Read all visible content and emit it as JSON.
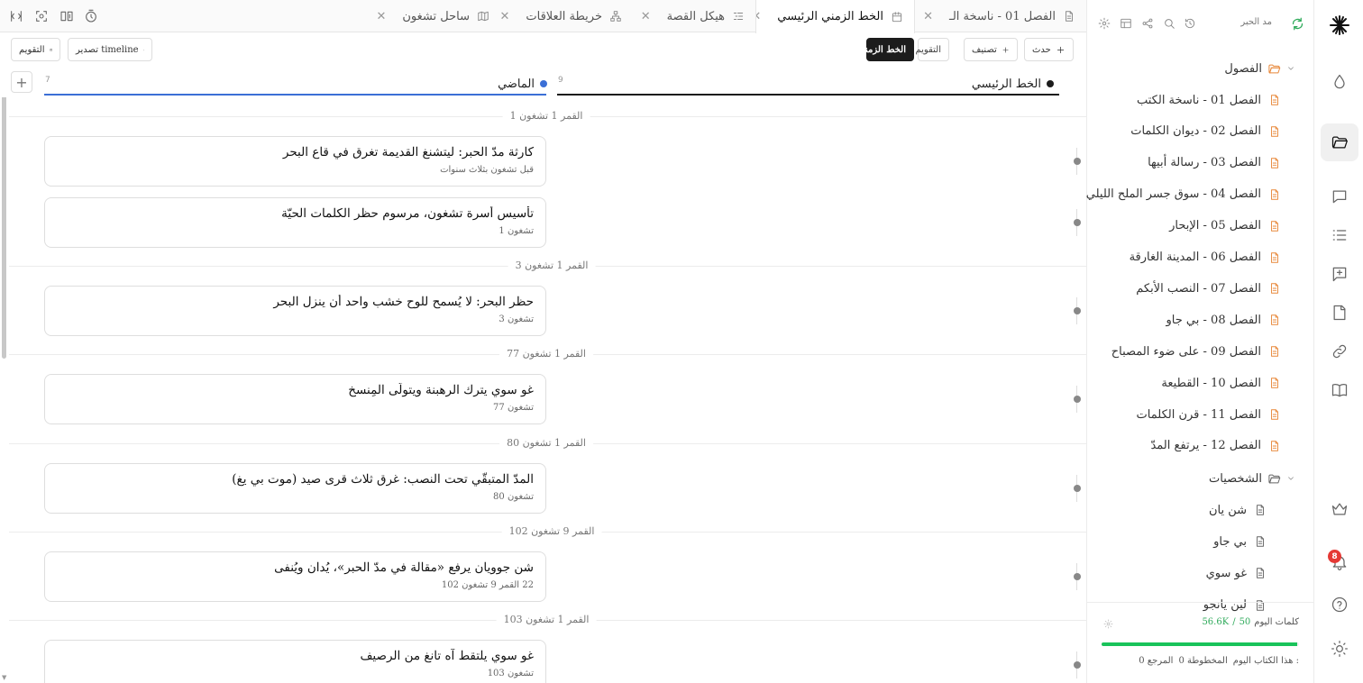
{
  "tabs": [
    {
      "label": "الفصل 01 - ناسخة الـ",
      "icon": "document-icon",
      "active": false
    },
    {
      "label": "الخط الزمني الرئيسي",
      "icon": "calendar-icon",
      "active": true
    },
    {
      "label": "هيكل القصة",
      "icon": "outline-icon",
      "active": false
    },
    {
      "label": "خريطة العلاقات",
      "icon": "network-icon",
      "active": false
    },
    {
      "label": "ساحل تشغون",
      "icon": "map-icon",
      "active": false
    }
  ],
  "toolbar": {
    "add_event": "حدث",
    "add_category": "تصنيف",
    "calendar_view": "التقويم",
    "timeline_view": "الخط الزمني",
    "export": "تصدير timeline",
    "calendar": "التقويم"
  },
  "tracks": {
    "main": {
      "name": "الخط الرئيسي",
      "count": "9",
      "color": "#1c1c1c"
    },
    "past": {
      "name": "الماضي",
      "count": "7",
      "color": "#3b6fd6"
    }
  },
  "timeline": {
    "sections": [
      {
        "label": "القمر 1 تشغون 1"
      },
      {
        "label": "القمر 1 تشغون 3"
      },
      {
        "label": "القمر 1 تشغون 77"
      },
      {
        "label": "القمر 1 تشغون 80"
      },
      {
        "label": "القمر 9 تشغون 102"
      },
      {
        "label": "القمر 1 تشغون 103"
      }
    ],
    "events": [
      {
        "title": "كارثة مدّ الحبر: ليتشنغ القديمة تغرق في قاع البحر",
        "date": "قبل تشغون بثلاث سنوات"
      },
      {
        "title": "تأسيس أسرة تشغون، مرسوم حظر الكلمات الحيّة",
        "date": "تشغون 1"
      },
      {
        "title": "حظر البحر: لا يُسمح للوح خشب واحد أن ينزل البحر",
        "date": "تشغون 3"
      },
      {
        "title": "غو سوي يترك الرهبنة ويتولّى المِنسخ",
        "date": "تشغون 77"
      },
      {
        "title": "المدّ المتبقّي تحت النصب: غرق ثلاث قرى صيد (موت بي يغ)",
        "date": "تشغون 80"
      },
      {
        "title": "شن جوويان يرفع «مقالة في مدّ الحبر»، يُدان ويُنفى",
        "date": "22 القمر 9 تشغون 102"
      },
      {
        "title": "غو سوي يلتقط آه تانغ من الرصيف",
        "date": "تشغون 103"
      }
    ]
  },
  "sidebar": {
    "title": "مد الحبر",
    "chapters_folder": "الفصول",
    "chapters": [
      "الفصل 01 - ناسخة الكتب",
      "الفصل 02 - ديوان الكلمات",
      "الفصل 03 - رسالة أبيها",
      "الفصل 04 - سوق جسر الملح الليلي",
      "الفصل 05 - الإبحار",
      "الفصل 06 - المدينة الغارقة",
      "الفصل 07 - النصب الأبكم",
      "الفصل 08 - بي جاو",
      "الفصل 09 - على ضوء المصباح",
      "الفصل 10 - القطيعة",
      "الفصل 11 - قرن الكلمات",
      "الفصل 12 - يرتفع المدّ"
    ],
    "characters_folder": "الشخصيات",
    "characters": [
      "شن يان",
      "بي جاو",
      "غو سوي",
      "لين يانجو"
    ],
    "footer": {
      "words_today_label": "كلمات اليوم",
      "words_today": "50",
      "words_goal": "56.6K",
      "goal_progress": 0.99,
      "book_today_label": "هذا الكتاب اليوم :",
      "outline_label": "المخطوطة 0",
      "reference_label": "المرجع 0"
    }
  },
  "rail": {
    "notification_count": "8"
  },
  "colors": {
    "accent_green": "#19c35a",
    "chapter_orange": "#e8883a",
    "past_track_blue": "#3b6fd6"
  }
}
